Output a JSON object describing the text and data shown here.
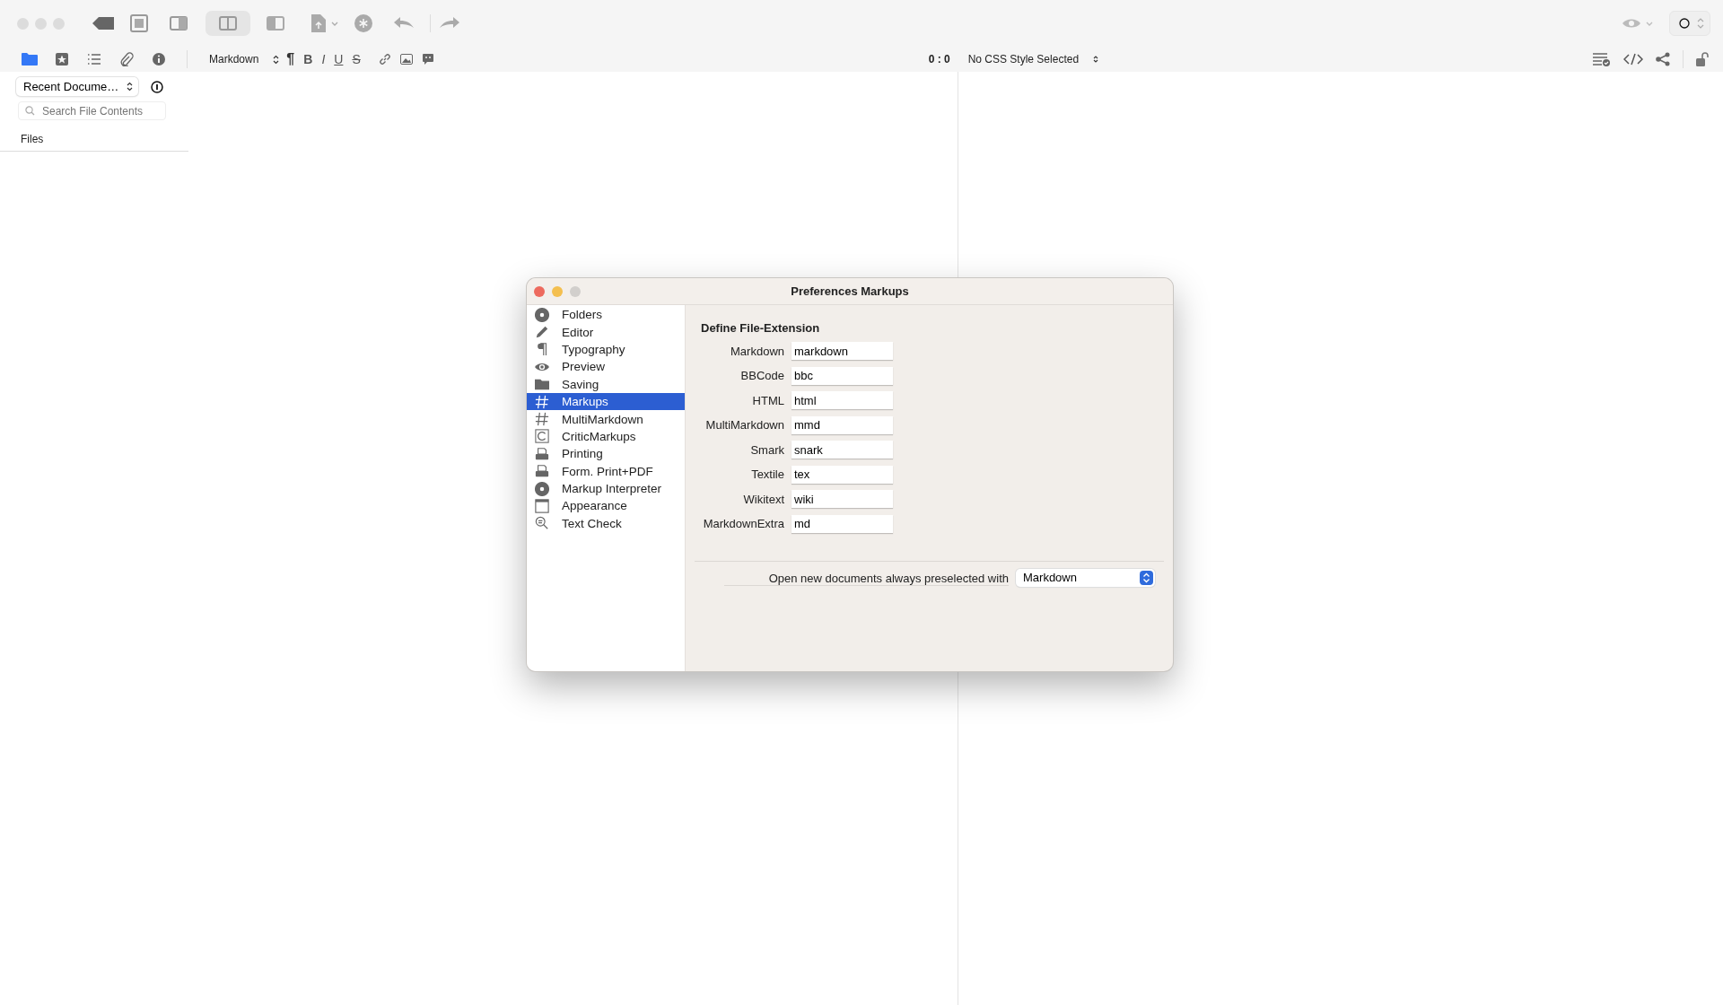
{
  "sidebar_tabs": [
    {
      "selected": true
    },
    {
      "selected": false
    },
    {
      "selected": false
    },
    {
      "selected": false
    },
    {
      "selected": false
    }
  ],
  "toolbar": {
    "syntax_popup": "Markdown",
    "format_buttons": [
      "¶",
      "B",
      "I",
      "U",
      "S"
    ],
    "cursor_position": "0 : 0",
    "css_popup": "No CSS Style Selected"
  },
  "sidebar": {
    "document_popup": "Recent Docume…",
    "search": {
      "placeholder": "Search File Contents"
    },
    "section": "Files"
  },
  "preferences": {
    "title": "Preferences Markups",
    "categories": [
      {
        "label": "Folders",
        "selected": false
      },
      {
        "label": "Editor",
        "selected": false
      },
      {
        "label": "Typography",
        "selected": false
      },
      {
        "label": "Preview",
        "selected": false
      },
      {
        "label": "Saving",
        "selected": false
      },
      {
        "label": "Markups",
        "selected": true
      },
      {
        "label": "MultiMarkdown",
        "selected": false
      },
      {
        "label": "CriticMarkups",
        "selected": false
      },
      {
        "label": "Printing",
        "selected": false
      },
      {
        "label": "Form. Print+PDF",
        "selected": false
      },
      {
        "label": "Markup Interpreter",
        "selected": false
      },
      {
        "label": "Appearance",
        "selected": false
      },
      {
        "label": "Text Check",
        "selected": false
      }
    ],
    "heading": "Define File-Extension",
    "extensions": [
      {
        "label": "Markdown",
        "value": "markdown"
      },
      {
        "label": "BBCode",
        "value": "bbc"
      },
      {
        "label": "HTML",
        "value": "html"
      },
      {
        "label": "MultiMarkdown",
        "value": "mmd"
      },
      {
        "label": "Smark",
        "value": "snark"
      },
      {
        "label": "Textile",
        "value": "tex"
      },
      {
        "label": "Wikitext",
        "value": "wiki"
      },
      {
        "label": "MarkdownExtra",
        "value": "md"
      }
    ],
    "default_label": "Open new documents always preselected with",
    "default_popup": "Markdown"
  }
}
